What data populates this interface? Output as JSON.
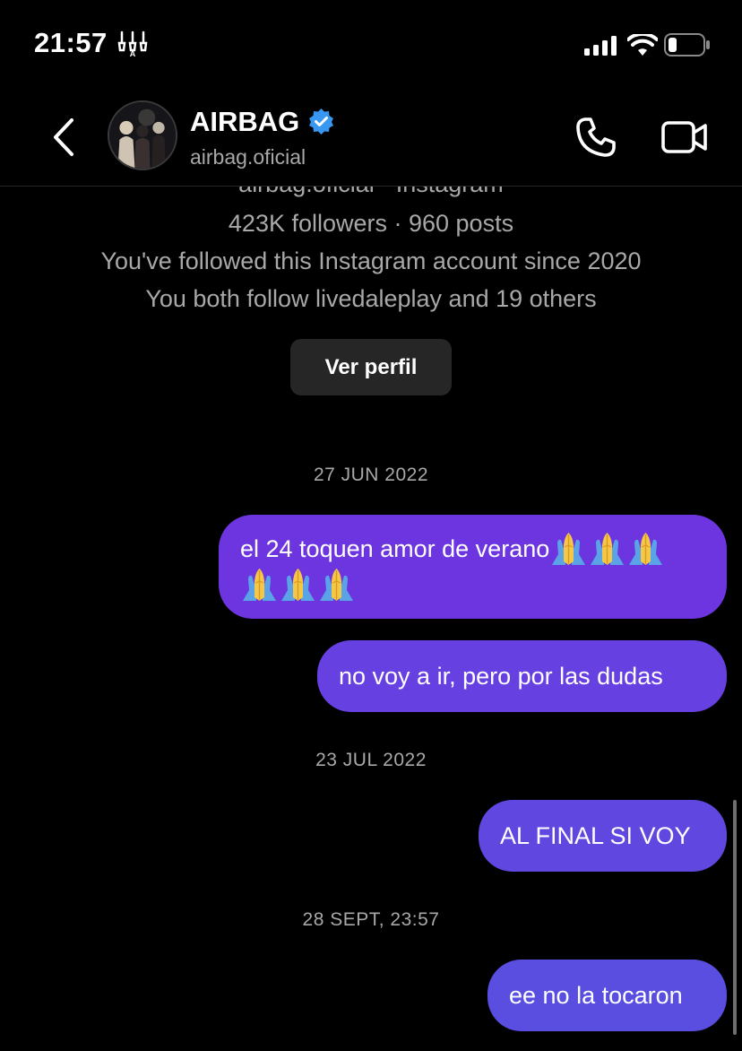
{
  "status_bar": {
    "time": "21:57"
  },
  "header": {
    "name": "AIRBAG",
    "handle": "airbag.oficial"
  },
  "profile_info": {
    "cut_line": "airbag.oficial · Instagram",
    "followers": "423K followers · 960 posts",
    "since": "You've followed this Instagram account since 2020",
    "mutual": "You both follow livedaleplay and 19 others",
    "button_label": "Ver perfil"
  },
  "messages": [
    {
      "date": "27 JUN 2022"
    },
    {
      "text_line1": "el 24 toquen amor de verano",
      "emoji": "folded-hands-emoji",
      "emoji_count": 6
    },
    {
      "text": "no voy a ir, pero por las dudas"
    },
    {
      "date": "23 JUL 2022"
    },
    {
      "text": "AL FINAL SI VOY"
    },
    {
      "date": "28 SEPT, 23:57"
    },
    {
      "text": "ee no la tocaron"
    }
  ],
  "icons": {
    "back": "chevron-left-icon",
    "verified": "verified-badge-icon",
    "phone": "phone-icon",
    "video": "video-camera-icon",
    "signal": "cellular-signal-icon",
    "wifi": "wifi-icon",
    "battery": "battery-icon"
  },
  "colors": {
    "background": "#000000",
    "verified": "#3897f0",
    "bubble_top": "#6d35e0",
    "bubble_bottom": "#594ee0",
    "secondary_text": "#a8a8a8"
  }
}
